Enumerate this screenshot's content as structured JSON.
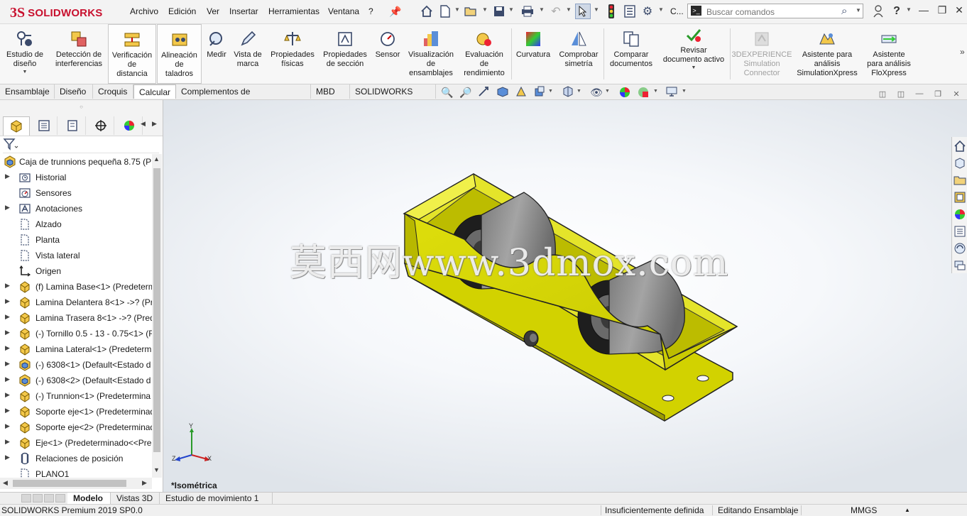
{
  "app": {
    "logo_ds": "3S",
    "logo_text": "SOLIDWORKS"
  },
  "menu": [
    "Archivo",
    "Edición",
    "Ver",
    "Insertar",
    "Herramientas",
    "Ventana",
    "?"
  ],
  "quick_access": [
    "home-icon",
    "new-document-icon",
    "open-icon",
    "save-icon",
    "print-icon",
    "undo-icon",
    "select-icon",
    "rebuild-icon",
    "file-properties-icon",
    "options-icon"
  ],
  "quick_access_more": "C...",
  "search": {
    "placeholder": "Buscar comandos",
    "prompt_glyph": ">_"
  },
  "ribbon": [
    {
      "label1": "Estudio de",
      "label2": "diseño",
      "label3": "",
      "has_dropdown": true
    },
    {
      "label1": "Detección de",
      "label2": "interferencias",
      "label3": ""
    },
    {
      "label1": "Verificación",
      "label2": "de",
      "label3": "distancia"
    },
    {
      "label1": "Alineación",
      "label2": "de",
      "label3": "taladros"
    },
    {
      "label1": "Medir",
      "label2": "",
      "label3": ""
    },
    {
      "label1": "Vista de",
      "label2": "marca",
      "label3": ""
    },
    {
      "label1": "Propiedades",
      "label2": "físicas",
      "label3": ""
    },
    {
      "label1": "Propiedades",
      "label2": "de sección",
      "label3": ""
    },
    {
      "label1": "Sensor",
      "label2": "",
      "label3": ""
    },
    {
      "label1": "Visualización",
      "label2": "de",
      "label3": "ensamblajes"
    },
    {
      "label1": "Evaluación",
      "label2": "de",
      "label3": "rendimiento"
    },
    {
      "label1": "Curvatura",
      "label2": "",
      "label3": ""
    },
    {
      "label1": "Comprobar",
      "label2": "simetría",
      "label3": ""
    },
    {
      "label1": "Comparar",
      "label2": "documentos",
      "label3": ""
    },
    {
      "label1": "Revisar",
      "label2": "documento activo",
      "label3": "",
      "has_dropdown": true
    },
    {
      "label1": "3DEXPERIENCE",
      "label2": "Simulation",
      "label3": "Connector",
      "disabled": true
    },
    {
      "label1": "Asistente para",
      "label2": "análisis",
      "label3": "SimulationXpress"
    },
    {
      "label1": "Asistente",
      "label2": "para análisis",
      "label3": "FloXpress"
    }
  ],
  "tabs": [
    "Ensamblaje",
    "Diseño",
    "Croquis",
    "Calcular",
    "Complementos de SOLIDWORKS",
    "MBD",
    "SOLIDWORKS CAM"
  ],
  "active_tab": "Calcular",
  "heads_up_icons": [
    "zoom-to-fit-icon",
    "zoom-area-icon",
    "previous-view-icon",
    "section-view-icon",
    "dynamic-annotation-icon",
    "view-orientation-icon",
    "display-style-icon",
    "hide-show-icon",
    "edit-appearance-icon",
    "apply-scene-icon",
    "view-settings-icon"
  ],
  "tree": {
    "root": "Caja de trunnions pequeña 8.75  (P",
    "items": [
      {
        "label": "Historial",
        "icon": "history-folder-icon",
        "expand": true
      },
      {
        "label": "Sensores",
        "icon": "sensors-icon",
        "expand": false
      },
      {
        "label": "Anotaciones",
        "icon": "annotations-icon",
        "expand": true
      },
      {
        "label": "Alzado",
        "icon": "plane-icon",
        "expand": false
      },
      {
        "label": "Planta",
        "icon": "plane-icon",
        "expand": false
      },
      {
        "label": "Vista lateral",
        "icon": "plane-icon",
        "expand": false
      },
      {
        "label": "Origen",
        "icon": "origin-icon",
        "expand": false
      },
      {
        "label": "(f) Lamina Base<1> (Predeterm",
        "icon": "part-icon",
        "expand": true
      },
      {
        "label": "Lamina Delantera 8<1> ->? (Pr",
        "icon": "part-icon",
        "expand": true
      },
      {
        "label": "Lamina Trasera 8<1> ->? (Pred",
        "icon": "part-icon",
        "expand": true
      },
      {
        "label": "(-) Tornillo 0.5 - 13 - 0.75<1> (F",
        "icon": "part-icon",
        "expand": true
      },
      {
        "label": "Lamina Lateral<1> (Predeterm",
        "icon": "part-icon",
        "expand": true
      },
      {
        "label": "(-) 6308<1> (Default<Estado d",
        "icon": "assembly-icon",
        "expand": true
      },
      {
        "label": "(-) 6308<2> (Default<Estado d",
        "icon": "assembly-icon",
        "expand": true
      },
      {
        "label": "(-) Trunnion<1> (Predetermina",
        "icon": "part-icon",
        "expand": true
      },
      {
        "label": "Soporte eje<1> (Predeterminad",
        "icon": "part-icon",
        "expand": true
      },
      {
        "label": "Soporte eje<2> (Predeterminad",
        "icon": "part-icon",
        "expand": true
      },
      {
        "label": "Eje<1> (Predeterminado<<Pre",
        "icon": "part-icon",
        "expand": true
      },
      {
        "label": "Relaciones de posición",
        "icon": "mates-icon",
        "expand": true
      },
      {
        "label": "PLANO1",
        "icon": "plane-icon",
        "expand": false
      }
    ]
  },
  "graphics": {
    "watermark": "莫西网www.3dmox.com",
    "view_name": "*Isométrica",
    "triad": {
      "x": "X",
      "y": "Y",
      "z": "Z"
    }
  },
  "task_pane_icons": [
    "home-icon",
    "design-library-icon",
    "file-explorer-icon",
    "view-palette-icon",
    "appearances-icon",
    "custom-properties-icon",
    "solidworks-resources-icon",
    "forum-icon"
  ],
  "bottom_tabs": [
    "Modelo",
    "Vistas 3D",
    "Estudio de movimiento 1"
  ],
  "active_bottom_tab": "Modelo",
  "status": {
    "product": "SOLIDWORKS Premium 2019 SP0.0",
    "definition": "Insuficientemente definida",
    "mode": "Editando Ensamblaje",
    "units": "MMGS"
  },
  "colors": {
    "brand_red": "#c8102e",
    "part_yellow": "#d8d800",
    "roller_gray": "#8c8c8c"
  }
}
